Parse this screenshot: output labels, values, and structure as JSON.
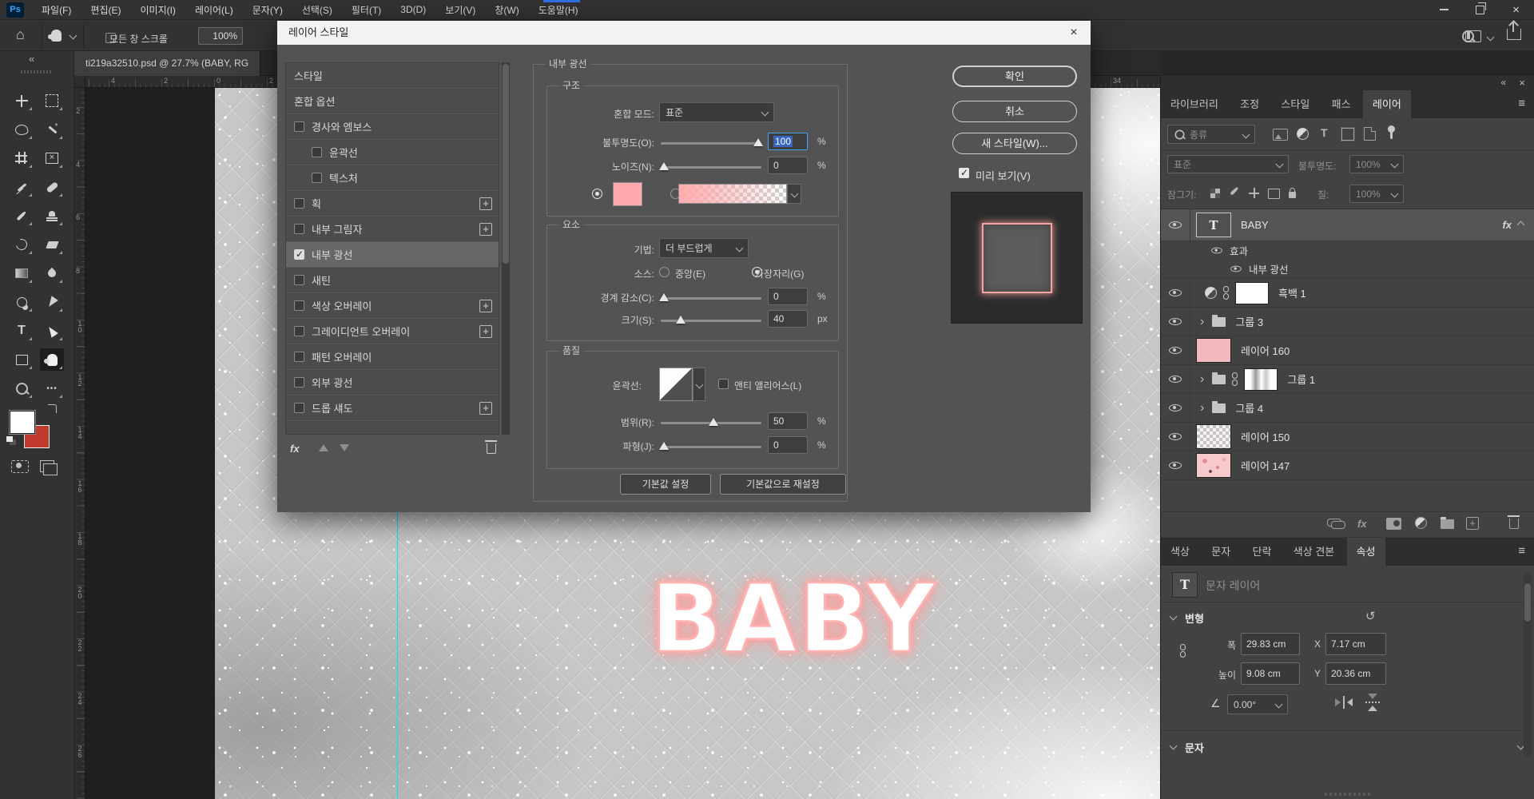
{
  "colors": {
    "accent_pink": "#ffabad",
    "glow_pink": "#ff9d9d",
    "selection_blue": "#3a66c0",
    "guide_cyan": "#00e8e8",
    "foreground_swatch": "#ffffff",
    "background_swatch": "#c0392f"
  },
  "icons": {
    "logo": "Ps",
    "close": "×",
    "collapse_left": "«",
    "hamburger": "≡",
    "home": "⌂",
    "ellipsis": "•••",
    "reset": "↺",
    "angle": "∠",
    "group_expand": "›",
    "type_letter": "T",
    "fx": "fx",
    "plus": "+"
  },
  "menubar": {
    "items": [
      "파일(F)",
      "편집(E)",
      "이미지(I)",
      "레이어(L)",
      "문자(Y)",
      "선택(S)",
      "필터(T)",
      "3D(D)",
      "보기(V)",
      "창(W)",
      "도움말(H)"
    ]
  },
  "options_bar": {
    "scroll_all_label": "모든 창 스크롤",
    "zoom_value": "100%"
  },
  "toolbar": {
    "tools": [
      "move",
      "marquee",
      "lasso",
      "magic-wand",
      "crop",
      "slice",
      "eyedropper",
      "healing",
      "brush",
      "stamp",
      "history-brush",
      "eraser",
      "gradient",
      "blur",
      "dodge",
      "pen",
      "type",
      "path-select",
      "shape",
      "hand",
      "zoom",
      "more"
    ]
  },
  "document": {
    "tab_title": "ti219a32510.psd @ 27.7% (BABY, RG",
    "canvas_word": "BABY",
    "ruler_top_numbers": [
      "4",
      "2",
      "0",
      "2",
      "34"
    ],
    "ruler_left_numbers": [
      "2",
      "4",
      "6",
      "8",
      "10",
      "12",
      "14",
      "16",
      "18",
      "20",
      "22",
      "24",
      "26"
    ]
  },
  "dialog": {
    "title": "레이어 스타일",
    "styles_list": [
      {
        "label": "스타일"
      },
      {
        "label": "혼합 옵션"
      },
      {
        "label": "경사와 엠보스",
        "checked": false
      },
      {
        "label": "윤곽선",
        "checked": false
      },
      {
        "label": "텍스처",
        "checked": false
      },
      {
        "label": "획",
        "checked": false,
        "plus": true
      },
      {
        "label": "내부 그림자",
        "checked": false,
        "plus": true
      },
      {
        "label": "내부 광선",
        "checked": true,
        "selected": true
      },
      {
        "label": "새틴",
        "checked": false
      },
      {
        "label": "색상 오버레이",
        "checked": false,
        "plus": true
      },
      {
        "label": "그레이디언트 오버레이",
        "checked": false,
        "plus": true
      },
      {
        "label": "패턴 오버레이",
        "checked": false
      },
      {
        "label": "외부 광선",
        "checked": false
      },
      {
        "label": "드롭 섀도",
        "checked": false,
        "plus": true
      }
    ],
    "inner_glow": {
      "section_title": "내부 광선",
      "structure": {
        "title": "구조",
        "blend_mode_label": "혼합 모드:",
        "blend_mode_value": "표준",
        "opacity_label": "불투명도(O):",
        "opacity_value": "100",
        "opacity_unit": "%",
        "noise_label": "노이즈(N):",
        "noise_value": "0",
        "noise_unit": "%"
      },
      "elements": {
        "title": "요소",
        "technique_label": "기법:",
        "technique_value": "더 부드럽게",
        "source_label": "소스:",
        "source_center": "중앙(E)",
        "source_edge": "가장자리(G)",
        "choke_label": "경계 감소(C):",
        "choke_value": "0",
        "choke_unit": "%",
        "size_label": "크기(S):",
        "size_value": "40",
        "size_unit": "px"
      },
      "quality": {
        "title": "품질",
        "contour_label": "윤곽선:",
        "antialias_label": "앤티 앨리어스(L)",
        "range_label": "범위(R):",
        "range_value": "50",
        "range_unit": "%",
        "jitter_label": "파형(J):",
        "jitter_value": "0",
        "jitter_unit": "%"
      },
      "set_default": "기본값 설정",
      "reset_default": "기본값으로 재설정"
    },
    "actions": {
      "ok": "확인",
      "cancel": "취소",
      "new_style": "새 스타일(W)...",
      "preview": "미리 보기(V)"
    }
  },
  "layers_panel": {
    "tabs": [
      "라이브러리",
      "조정",
      "스타일",
      "패스",
      "레이어"
    ],
    "active_tab": "레이어",
    "filter_label": "종류",
    "blend_mode": "표준",
    "opacity_label": "불투명도:",
    "opacity_value": "100%",
    "lock_label": "잠그기:",
    "fill_label": "칠:",
    "fill_value": "100%",
    "layers": [
      {
        "name": "BABY",
        "children": [
          "효과",
          "내부 광선"
        ]
      },
      {
        "name": "흑백 1"
      },
      {
        "name": "그룹 3"
      },
      {
        "name": "레이어 160"
      },
      {
        "name": "그룹 1"
      },
      {
        "name": "그룹 4"
      },
      {
        "name": "레이어 150"
      },
      {
        "name": "레이어 147"
      }
    ]
  },
  "properties_panel": {
    "tabs": [
      "색상",
      "문자",
      "단락",
      "색상 견본",
      "속성"
    ],
    "active_tab": "속성",
    "layer_type": "문자 레이어",
    "transform": {
      "title": "변형",
      "width_label": "폭",
      "width_value": "29.83 cm",
      "x_label": "X",
      "x_value": "7.17 cm",
      "height_label": "높이",
      "height_value": "9.08 cm",
      "y_label": "Y",
      "y_value": "20.36 cm",
      "angle_value": "0.00°"
    },
    "character_title": "문자"
  }
}
